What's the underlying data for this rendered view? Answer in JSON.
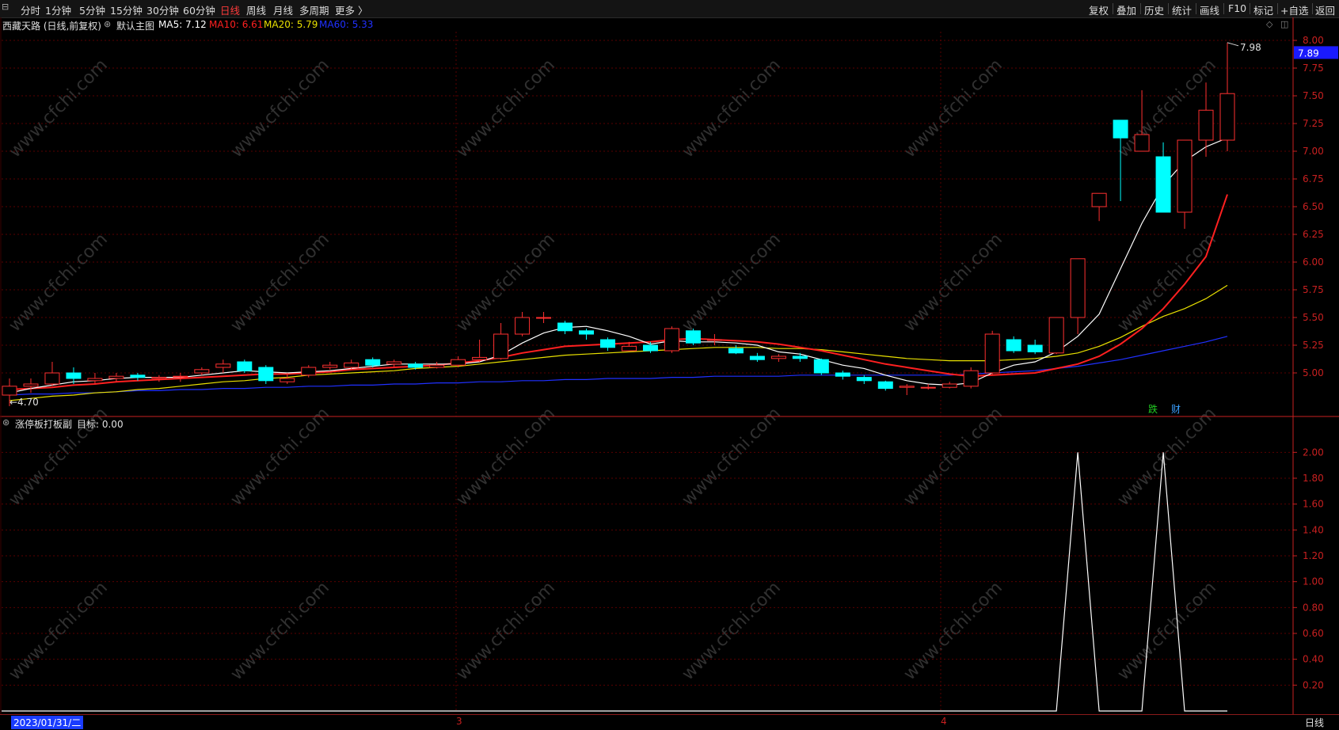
{
  "toolbar": {
    "window_icon": "chart-icon",
    "left_items": [
      "分时",
      "1分钟",
      "5分钟",
      "15分钟",
      "30分钟",
      "60分钟",
      "日线",
      "周线",
      "月线",
      "多周期",
      "更多 〉"
    ],
    "active_item": "日线",
    "right_items": [
      "复权",
      "叠加",
      "历史",
      "统计",
      "画线",
      "F10",
      "标记",
      "+自选",
      "返回"
    ]
  },
  "main_info": {
    "stock": "西藏天路 (日线,前复权)",
    "template": "默认主图",
    "ma5": "MA5: 7.12",
    "ma10": "MA10: 6.61",
    "ma20": "MA20: 5.79",
    "ma60": "MA60: 5.33"
  },
  "colors": {
    "ma5": "#ffffff",
    "ma10": "#ff2020",
    "ma20": "#e8e000",
    "ma60": "#2030ff",
    "up": "#ff3030",
    "down": "#00ffff",
    "grid": "#5a0000",
    "axis": "#c82020"
  },
  "price_axis": {
    "ticks": [
      "8.00",
      "7.75",
      "7.50",
      "7.25",
      "7.00",
      "6.75",
      "6.50",
      "6.25",
      "6.00",
      "5.75",
      "5.50",
      "5.25",
      "5.00"
    ],
    "current_price": "7.89",
    "high_label": "7.98",
    "low_label": "4.70"
  },
  "events": [
    "跌",
    "财"
  ],
  "sub_info": {
    "indicator": "涨停板打板副",
    "value": "目标: 0.00"
  },
  "sub_axis": {
    "ticks": [
      "2.00",
      "1.80",
      "1.60",
      "1.40",
      "1.20",
      "1.00",
      "0.80",
      "0.60",
      "0.40",
      "0.20"
    ]
  },
  "bottom": {
    "date": "2023/01/31/二",
    "month_marks": [
      "3",
      "4"
    ],
    "period": "日线"
  },
  "watermark": "www.cfchi.com",
  "chart_data": {
    "type": "candlestick",
    "candles": [
      [
        4.8,
        4.88,
        4.95,
        4.7
      ],
      [
        4.88,
        4.9,
        4.95,
        4.82
      ],
      [
        4.9,
        5.0,
        5.1,
        4.88
      ],
      [
        5.0,
        4.95,
        5.05,
        4.9
      ],
      [
        4.93,
        4.95,
        5.0,
        4.9
      ],
      [
        4.95,
        4.97,
        5.0,
        4.92
      ],
      [
        4.98,
        4.96,
        5.0,
        4.93
      ],
      [
        4.95,
        4.96,
        4.98,
        4.92
      ],
      [
        4.97,
        4.97,
        5.0,
        4.92
      ],
      [
        5.0,
        5.03,
        5.05,
        4.98
      ],
      [
        5.05,
        5.08,
        5.12,
        5.0
      ],
      [
        5.1,
        5.02,
        5.12,
        5.0
      ],
      [
        5.05,
        4.93,
        5.07,
        4.9
      ],
      [
        4.92,
        4.95,
        5.0,
        4.9
      ],
      [
        4.98,
        5.05,
        5.07,
        4.96
      ],
      [
        5.05,
        5.07,
        5.1,
        5.03
      ],
      [
        5.05,
        5.09,
        5.12,
        5.03
      ],
      [
        5.12,
        5.07,
        5.14,
        5.05
      ],
      [
        5.08,
        5.1,
        5.12,
        5.05
      ],
      [
        5.08,
        5.05,
        5.1,
        5.03
      ],
      [
        5.05,
        5.07,
        5.1,
        5.04
      ],
      [
        5.07,
        5.12,
        5.15,
        5.05
      ],
      [
        5.12,
        5.14,
        5.3,
        5.1
      ],
      [
        5.13,
        5.35,
        5.45,
        5.12
      ],
      [
        5.35,
        5.5,
        5.55,
        5.33
      ],
      [
        5.5,
        5.5,
        5.55,
        5.45
      ],
      [
        5.45,
        5.38,
        5.47,
        5.35
      ],
      [
        5.38,
        5.35,
        5.4,
        5.3
      ],
      [
        5.3,
        5.23,
        5.32,
        5.2
      ],
      [
        5.2,
        5.24,
        5.28,
        5.2
      ],
      [
        5.25,
        5.2,
        5.28,
        5.18
      ],
      [
        5.2,
        5.4,
        5.42,
        5.18
      ],
      [
        5.38,
        5.27,
        5.4,
        5.25
      ],
      [
        5.3,
        5.3,
        5.35,
        5.25
      ],
      [
        5.22,
        5.18,
        5.25,
        5.17
      ],
      [
        5.15,
        5.12,
        5.18,
        5.1
      ],
      [
        5.13,
        5.15,
        5.17,
        5.1
      ],
      [
        5.15,
        5.13,
        5.18,
        5.1
      ],
      [
        5.12,
        5.0,
        5.13,
        4.98
      ],
      [
        5.0,
        4.97,
        5.02,
        4.94
      ],
      [
        4.96,
        4.93,
        4.98,
        4.9
      ],
      [
        4.92,
        4.86,
        4.93,
        4.84
      ],
      [
        4.87,
        4.88,
        4.9,
        4.8
      ],
      [
        4.87,
        4.87,
        4.9,
        4.85
      ],
      [
        4.87,
        4.9,
        4.92,
        4.86
      ],
      [
        4.88,
        5.02,
        5.05,
        4.86
      ],
      [
        5.0,
        5.35,
        5.38,
        4.98
      ],
      [
        5.3,
        5.2,
        5.33,
        5.18
      ],
      [
        5.25,
        5.19,
        5.3,
        5.17
      ],
      [
        5.18,
        5.5,
        5.5,
        5.17
      ],
      [
        5.5,
        6.03,
        6.03,
        5.35
      ],
      [
        6.5,
        6.62,
        6.62,
        6.37
      ],
      [
        7.28,
        7.12,
        7.28,
        6.55
      ],
      [
        7.0,
        7.15,
        7.55,
        7.0
      ],
      [
        6.95,
        6.45,
        7.08,
        6.45
      ],
      [
        6.45,
        7.1,
        7.1,
        6.3
      ],
      [
        7.1,
        7.37,
        7.62,
        6.95
      ],
      [
        7.1,
        7.52,
        7.98,
        7.0
      ]
    ],
    "ma5": [
      4.82,
      4.86,
      4.89,
      4.92,
      4.93,
      4.95,
      4.96,
      4.96,
      4.96,
      4.98,
      5.0,
      5.02,
      5.01,
      5.0,
      5.01,
      5.02,
      5.04,
      5.06,
      5.08,
      5.08,
      5.08,
      5.08,
      5.1,
      5.16,
      5.27,
      5.36,
      5.41,
      5.42,
      5.38,
      5.33,
      5.26,
      5.29,
      5.28,
      5.28,
      5.27,
      5.25,
      5.19,
      5.17,
      5.12,
      5.07,
      5.04,
      4.98,
      4.93,
      4.9,
      4.89,
      4.91,
      5.0,
      5.07,
      5.1,
      5.19,
      5.33,
      5.53,
      5.94,
      6.35,
      6.69,
      6.91,
      7.04,
      7.12
    ],
    "ma10": [
      4.85,
      4.86,
      4.87,
      4.89,
      4.9,
      4.92,
      4.93,
      4.94,
      4.95,
      4.96,
      4.97,
      4.98,
      4.99,
      4.99,
      5.0,
      5.01,
      5.03,
      5.04,
      5.05,
      5.06,
      5.07,
      5.09,
      5.11,
      5.14,
      5.18,
      5.21,
      5.24,
      5.25,
      5.26,
      5.27,
      5.28,
      5.3,
      5.31,
      5.3,
      5.29,
      5.28,
      5.26,
      5.23,
      5.2,
      5.16,
      5.12,
      5.08,
      5.05,
      5.02,
      4.99,
      4.97,
      4.98,
      4.99,
      5.0,
      5.04,
      5.08,
      5.15,
      5.26,
      5.4,
      5.58,
      5.8,
      6.05,
      6.61
    ],
    "ma20": [
      4.75,
      4.77,
      4.79,
      4.8,
      4.82,
      4.83,
      4.85,
      4.86,
      4.88,
      4.9,
      4.92,
      4.93,
      4.95,
      4.96,
      4.98,
      4.99,
      5.0,
      5.01,
      5.02,
      5.04,
      5.05,
      5.06,
      5.08,
      5.1,
      5.12,
      5.14,
      5.16,
      5.17,
      5.18,
      5.19,
      5.2,
      5.21,
      5.22,
      5.23,
      5.23,
      5.23,
      5.22,
      5.22,
      5.21,
      5.19,
      5.17,
      5.15,
      5.13,
      5.12,
      5.11,
      5.11,
      5.11,
      5.12,
      5.13,
      5.15,
      5.18,
      5.24,
      5.32,
      5.42,
      5.51,
      5.58,
      5.67,
      5.79
    ],
    "ma60": [
      4.8,
      4.81,
      4.81,
      4.82,
      4.82,
      4.83,
      4.84,
      4.84,
      4.85,
      4.85,
      4.86,
      4.86,
      4.87,
      4.87,
      4.88,
      4.88,
      4.89,
      4.89,
      4.9,
      4.9,
      4.91,
      4.91,
      4.92,
      4.92,
      4.93,
      4.93,
      4.94,
      4.94,
      4.95,
      4.95,
      4.95,
      4.96,
      4.96,
      4.97,
      4.97,
      4.97,
      4.97,
      4.98,
      4.98,
      4.98,
      4.98,
      4.98,
      4.98,
      4.98,
      4.98,
      4.99,
      5.0,
      5.01,
      5.02,
      5.04,
      5.06,
      5.09,
      5.12,
      5.16,
      5.2,
      5.24,
      5.28,
      5.33
    ],
    "signal": [
      0,
      0,
      0,
      0,
      0,
      0,
      0,
      0,
      0,
      0,
      0,
      0,
      0,
      0,
      0,
      0,
      0,
      0,
      0,
      0,
      0,
      0,
      0,
      0,
      0,
      0,
      0,
      0,
      0,
      0,
      0,
      0,
      0,
      0,
      0,
      0,
      0,
      0,
      0,
      0,
      0,
      0,
      0,
      0,
      0,
      0,
      0,
      0,
      0,
      0,
      2,
      0,
      0,
      0,
      2,
      0,
      0,
      0
    ],
    "ylim": [
      4.65,
      8.05
    ],
    "sub_ylim": [
      0,
      2.1
    ]
  }
}
